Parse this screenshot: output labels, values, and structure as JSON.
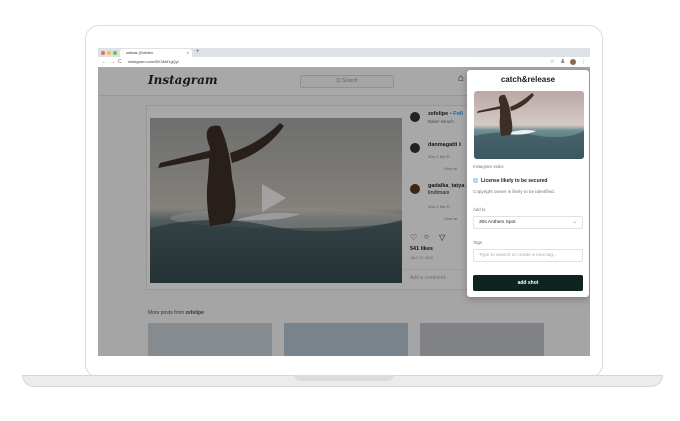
{
  "browser": {
    "tab_title": "cmkas (Golden",
    "tab_close": "×",
    "new_tab": "+",
    "nav_back": "←",
    "nav_forward": "→",
    "nav_reload": "C",
    "url": "instagram.com/BX3kM1gQy/",
    "ext_star": "☆",
    "ext_amp": "&",
    "ext_menu": "⋮"
  },
  "instagram": {
    "logo": "Instagram",
    "search_placeholder": "Q Search",
    "home_icon": "⌂",
    "post_author": "zefelipe",
    "follow_label": "• Foll",
    "location": "Baker Beach",
    "comments": [
      {
        "user": "danmagatti",
        "extra": "li",
        "meta": "40w  1 like  R",
        "view": "View re"
      },
      {
        "user": "gadalka_tatya",
        "line2": "lindimais",
        "meta": "40w  1 like  R",
        "view": "View re"
      }
    ],
    "likes": "541 likes",
    "date": "JULY 17, 2019",
    "add_comment": "Add a comment...",
    "more_posts_prefix": "More posts from",
    "more_posts_user": "zefelipe"
  },
  "extension": {
    "brand": "catch&release",
    "media_type": "Instagram video",
    "license_title": "License likely to be secured",
    "license_sub": "Copyright owner is likely to be identified.",
    "add_to_label": "Add to",
    "add_to_value": "30s Anthem Spot",
    "tags_label": "Tags",
    "tags_placeholder": "Type to search or create a new tag...",
    "add_button": "add shot"
  },
  "colors": {
    "panel_button": "#0f2321",
    "license_check": "#b7d7ef",
    "browser_dot_red": "#ee6a5f",
    "browser_dot_yellow": "#f5bd4f",
    "browser_dot_green": "#61c454"
  }
}
